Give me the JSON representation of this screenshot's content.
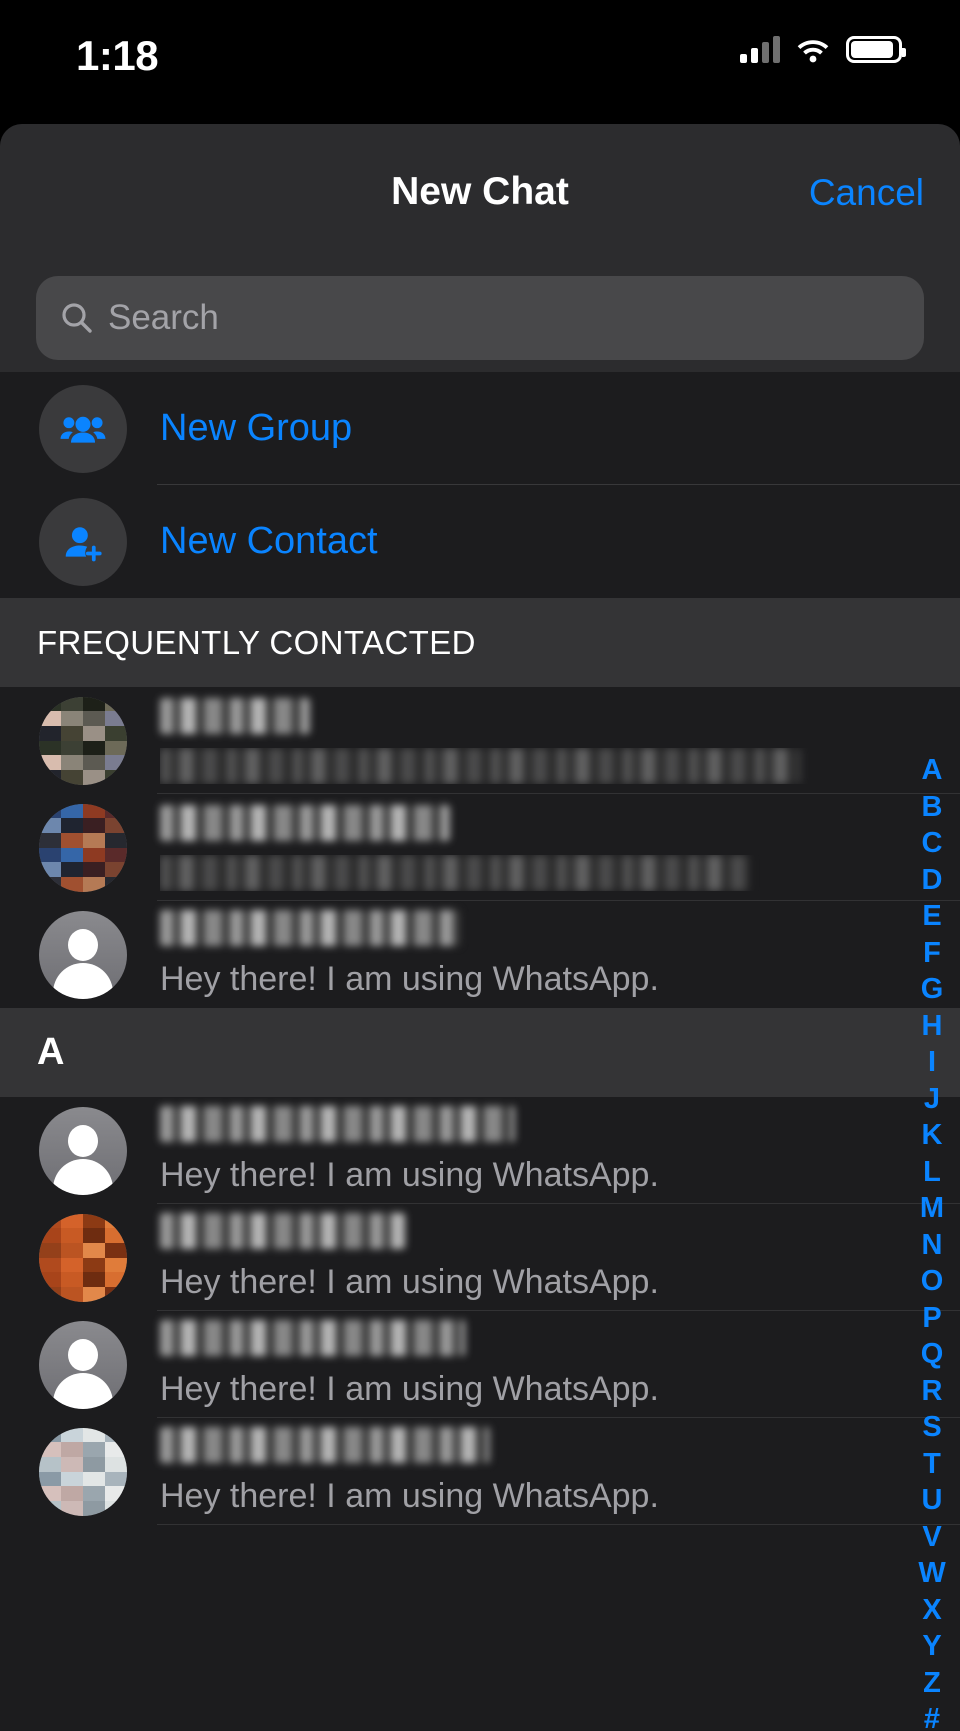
{
  "status_bar": {
    "time": "1:18",
    "cellular_icon": "signal-bars-icon",
    "wifi_icon": "wifi-icon",
    "battery_icon": "battery-icon"
  },
  "navbar": {
    "title": "New Chat",
    "cancel_label": "Cancel"
  },
  "search": {
    "placeholder": "Search",
    "value": "",
    "icon": "search-icon"
  },
  "actions": [
    {
      "label": "New Group",
      "icon": "group-people-icon"
    },
    {
      "label": "New Contact",
      "icon": "person-add-icon"
    }
  ],
  "sections": [
    {
      "header": "FREQUENTLY CONTACTED",
      "rows": [
        {
          "name_redacted": true,
          "name": "",
          "status": "",
          "status_redacted": true,
          "avatar": "photo",
          "avatar_tone": "olive",
          "name_width": 150,
          "status_width": 640
        },
        {
          "name_redacted": true,
          "name": "",
          "status": "",
          "status_redacted": true,
          "avatar": "photo",
          "avatar_tone": "rust",
          "name_width": 290,
          "status_width": 590
        },
        {
          "name_redacted": true,
          "name": "",
          "status": "Hey there! I am using WhatsApp.",
          "status_redacted": false,
          "avatar": "placeholder",
          "avatar_tone": "",
          "name_width": 300,
          "status_width": 0
        }
      ]
    },
    {
      "header": "A",
      "rows": [
        {
          "name_redacted": true,
          "name": "",
          "status": "Hey there! I am using WhatsApp.",
          "status_redacted": false,
          "avatar": "placeholder",
          "avatar_tone": "",
          "name_width": 355,
          "status_width": 0
        },
        {
          "name_redacted": true,
          "name": "",
          "status": "Hey there! I am using WhatsApp.",
          "status_redacted": false,
          "avatar": "photo",
          "avatar_tone": "orange",
          "name_width": 245,
          "status_width": 0
        },
        {
          "name_redacted": true,
          "name": "",
          "status": "Hey there! I am using WhatsApp.",
          "status_redacted": false,
          "avatar": "placeholder",
          "avatar_tone": "",
          "name_width": 305,
          "status_width": 0
        },
        {
          "name_redacted": true,
          "name": "",
          "status": "Hey there! I am using WhatsApp.",
          "status_redacted": false,
          "avatar": "photo",
          "avatar_tone": "pale",
          "name_width": 330,
          "status_width": 0
        }
      ]
    }
  ],
  "index_bar": {
    "letters": [
      "A",
      "B",
      "C",
      "D",
      "E",
      "F",
      "G",
      "H",
      "I",
      "J",
      "K",
      "L",
      "M",
      "N",
      "O",
      "P",
      "Q",
      "R",
      "S",
      "T",
      "U",
      "V",
      "W",
      "X",
      "Y",
      "Z",
      "#"
    ]
  },
  "colors": {
    "accent_blue": "#0a84ff",
    "sheet_bg": "#1c1c1e",
    "navbar_bg": "#2c2c2e",
    "section_header_bg": "#343436",
    "search_bg": "#48484a",
    "status_text": "#a0a0a5"
  }
}
